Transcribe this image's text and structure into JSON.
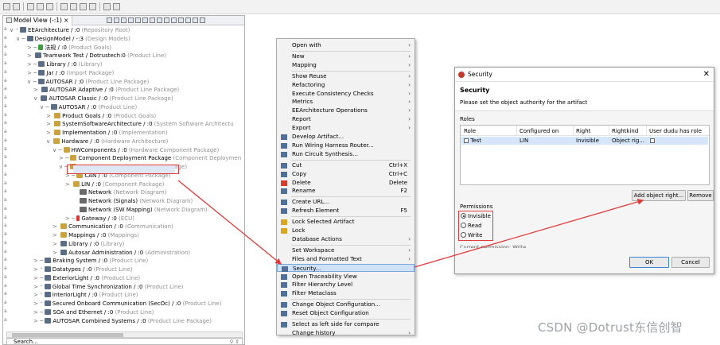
{
  "toolbar": {
    "icons": [
      "save-icon",
      "save-all-icon",
      "undo-icon",
      "redo-icon",
      "copy-icon",
      "record-icon",
      "filter-icon",
      "search-icon",
      "link-icon",
      "back-icon",
      "forward-icon"
    ]
  },
  "model_view": {
    "tab_label": "Model View (-:1)",
    "tree": [
      {
        "prefix": "∨ ⁺",
        "icon": "repo",
        "text": "EEArchitecture / :0",
        "meta": "(Repository Root)"
      },
      {
        "prefix": "∨ ─",
        "icon": "design",
        "text": "DesignModel / -:3",
        "meta": "(Design Models)"
      },
      {
        "prefix": "> ─",
        "icon": "goals",
        "text": "法规 / :0",
        "meta": "(Product Goals)"
      },
      {
        "prefix": "> ",
        "icon": "pl",
        "text": "Teamwork Test / Dotrustech:0",
        "meta": "(Product Line)"
      },
      {
        "prefix": "> ─",
        "icon": "lib",
        "text": "Library / :0",
        "meta": "(Library)"
      },
      {
        "prefix": "> ─",
        "icon": "jar",
        "text": "Jar / :0",
        "meta": "(Import Package)"
      },
      {
        "prefix": "∨ ─",
        "icon": "pkg",
        "text": "AUTOSAR / :0",
        "meta": "(Product Line Package)"
      },
      {
        "prefix": "> ",
        "icon": "pkg",
        "text": "AUTOSAR Adaptive / :0",
        "meta": "(Product Line Package)"
      },
      {
        "prefix": "∨ ",
        "icon": "pkg",
        "text": "AUTOSAR Classic / :0",
        "meta": "(Product Line Package)"
      },
      {
        "prefix": "∨ ─",
        "icon": "pl",
        "text": "AUTOSAR / :0",
        "meta": "(Product Line)"
      },
      {
        "prefix": "> ",
        "icon": "folder",
        "text": "Product Goals / :0",
        "meta": "(Product Goals)"
      },
      {
        "prefix": "> ",
        "icon": "folder",
        "text": "SystemSoftwareArchitecture / :0",
        "meta": "(System Software Architectu"
      },
      {
        "prefix": "> ",
        "icon": "folder",
        "text": "Implementation / :0",
        "meta": "(Implementation)"
      },
      {
        "prefix": "∨ ",
        "icon": "folder",
        "text": "Hardware / :0",
        "meta": "(Hardware Architecture)"
      },
      {
        "prefix": "∨ ─",
        "icon": "folder",
        "text": "HWComponents / :0",
        "meta": "(Hardware Component Package)"
      },
      {
        "prefix": "> ─",
        "icon": "folder",
        "text": "Component Deployment Package",
        "meta": "(Component Deploymen"
      },
      {
        "prefix": "∨ ─",
        "icon": "folder",
        "text": "Components / :0",
        "meta": "(Component Package)"
      },
      {
        "prefix": "> ─",
        "icon": "folder",
        "text": "CAN / :0",
        "meta": "(Component Package)"
      },
      {
        "prefix": "> ",
        "icon": "folder",
        "text": "LIN / :0",
        "meta": "(Component Package)"
      },
      {
        "prefix": "",
        "icon": "net",
        "text": "Network",
        "meta": "(Network Diagram)"
      },
      {
        "prefix": "",
        "icon": "net",
        "text": "Network (Signals)",
        "meta": "(Network Diagram)"
      },
      {
        "prefix": "",
        "icon": "net",
        "text": "Network (SW Mapping)",
        "meta": "(Network Diagram)"
      },
      {
        "prefix": "> ─",
        "icon": "ecu",
        "text": "Gateway / :0",
        "meta": "(ECU)"
      },
      {
        "prefix": "> ",
        "icon": "folder",
        "text": "Communication / :0",
        "meta": "(Communication)"
      },
      {
        "prefix": "> ",
        "icon": "folder",
        "text": "Mappings / :0",
        "meta": "(Mappings)"
      },
      {
        "prefix": "> ",
        "icon": "lib",
        "text": "Library / :0",
        "meta": "(Library)"
      },
      {
        "prefix": "> ",
        "icon": "admin",
        "text": "Autosar Administration / :0",
        "meta": "(Administration)"
      },
      {
        "prefix": "> ─",
        "icon": "pl",
        "text": "Braking System / :0",
        "meta": "(Product Line)"
      },
      {
        "prefix": "> ⁺",
        "icon": "pl",
        "text": "Datatypes / :0",
        "meta": "(Product Line)"
      },
      {
        "prefix": "> ─",
        "icon": "pl",
        "text": "ExteriorLight / :0",
        "meta": "(Product Line)"
      },
      {
        "prefix": "> ⁺",
        "icon": "pl",
        "text": "Global Time Synchronization / :0",
        "meta": "(Product Line)"
      },
      {
        "prefix": "> ⁺",
        "icon": "pl",
        "text": "InteriorLight / :0",
        "meta": "(Product Line)"
      },
      {
        "prefix": "> ⁺",
        "icon": "pl",
        "text": "Secured Onboard Communication (SecOc) / :0",
        "meta": "(Product Line)"
      },
      {
        "prefix": "> ─",
        "icon": "pl",
        "text": "SOA and Ethernet / :0",
        "meta": "(Product Line)"
      },
      {
        "prefix": "> ─",
        "icon": "pkg",
        "text": "AUTOSAR Combined Systems / :0",
        "meta": "(Product Line Package)"
      }
    ],
    "search_placeholder": "Search..."
  },
  "context_menu": {
    "items": [
      {
        "label": "Open with",
        "submenu": true
      },
      {
        "sep": true
      },
      {
        "label": "New",
        "submenu": true
      },
      {
        "label": "Mapping",
        "submenu": true
      },
      {
        "sep": true
      },
      {
        "label": "Show Reuse",
        "submenu": true
      },
      {
        "label": "Refactoring",
        "submenu": true
      },
      {
        "label": "Execute Consistency Checks",
        "submenu": true
      },
      {
        "label": "Metrics",
        "submenu": true
      },
      {
        "label": "EEArchitecture Operations",
        "submenu": true
      },
      {
        "label": "Report",
        "submenu": true
      },
      {
        "label": "Export",
        "submenu": true
      },
      {
        "label": "Develop Artifact...",
        "icon": "develop-icon"
      },
      {
        "label": "Run Wiring Harness Router...",
        "icon": "router-icon"
      },
      {
        "label": "Run Circuit Synthesis...",
        "icon": "circuit-icon"
      },
      {
        "sep": true
      },
      {
        "label": "Cut",
        "shortcut": "Ctrl+X",
        "icon": "cut-icon"
      },
      {
        "label": "Copy",
        "shortcut": "Ctrl+C",
        "icon": "copy-icon"
      },
      {
        "label": "Delete",
        "shortcut": "Delete",
        "icon": "delete-icon"
      },
      {
        "label": "Rename",
        "shortcut": "F2",
        "icon": "rename-icon"
      },
      {
        "sep": true
      },
      {
        "label": "Create URL...",
        "icon": "url-icon"
      },
      {
        "label": "Refresh Element",
        "shortcut": "F5",
        "icon": "refresh-icon"
      },
      {
        "sep": true
      },
      {
        "label": "Lock Selected Artifact",
        "icon": "lock-icon"
      },
      {
        "label": "Lock",
        "icon": "lock-icon"
      },
      {
        "label": "Database Actions",
        "submenu": true
      },
      {
        "sep": true
      },
      {
        "label": "Set Workspace",
        "submenu": true
      },
      {
        "label": "Files and Formatted Text",
        "submenu": true
      },
      {
        "label": "Security...",
        "icon": "security-icon",
        "selected": true
      },
      {
        "label": "Open Traceability View",
        "icon": "trace-icon"
      },
      {
        "label": "Filter Hierarchy Level",
        "icon": "filter-icon"
      },
      {
        "label": "Filter Metaclass",
        "icon": "filter-icon"
      },
      {
        "sep": true
      },
      {
        "label": "Change Object Configuration...",
        "icon": "config-icon"
      },
      {
        "label": "Reset Object Configuration",
        "icon": "config-icon"
      },
      {
        "sep": true
      },
      {
        "label": "Select as left side for compare",
        "icon": "compare-icon"
      },
      {
        "label": "Change history",
        "submenu": true
      }
    ]
  },
  "dialog": {
    "window_title": "Security",
    "heading": "Security",
    "description": "Please set the object authority for the artifact",
    "roles_label": "Roles",
    "columns": [
      "Role",
      "Configured on",
      "Right",
      "Rightkind",
      "User dudu has role"
    ],
    "rows": [
      {
        "role": "Test",
        "configured_on": "LIN",
        "right": "Invisible",
        "rightkind": "Object rig...",
        "has_role": false
      }
    ],
    "add_button": "Add object right...",
    "remove_button": "Remove",
    "permissions_label": "Permissions",
    "permissions": [
      {
        "label": "Invisible",
        "checked": true
      },
      {
        "label": "Read",
        "checked": false
      },
      {
        "label": "Write",
        "checked": false
      }
    ],
    "current_permission": "Current permission: Write",
    "ok_button": "OK",
    "cancel_button": "Cancel"
  },
  "watermark": "CSDN @Dotrust东信创智",
  "colors": {
    "annotation_red": "#e23a3a",
    "selection_blue": "#cfe2f8"
  }
}
